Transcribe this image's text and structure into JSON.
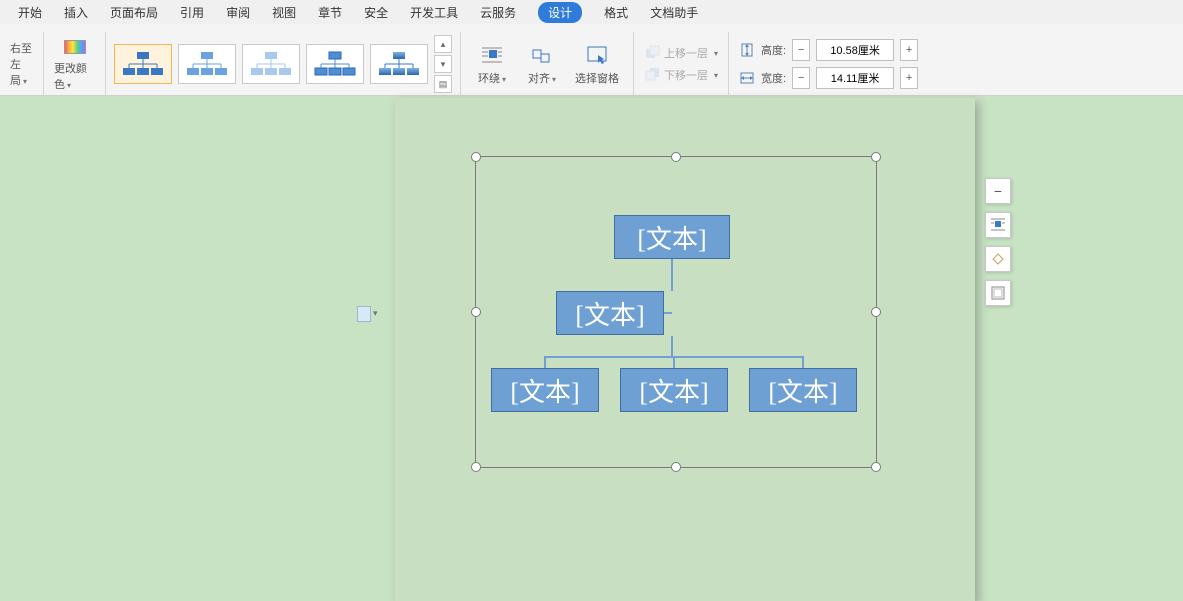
{
  "tabs": {
    "items": [
      "开始",
      "插入",
      "页面布局",
      "引用",
      "审阅",
      "视图",
      "章节",
      "安全",
      "开发工具",
      "云服务",
      "设计",
      "格式",
      "文档助手"
    ],
    "active_index": 10
  },
  "ribbon": {
    "rtl": {
      "l1": "右至左",
      "l2": "局"
    },
    "change_color": "更改颜色",
    "wrap": "环绕",
    "align": "对齐",
    "selection_pane": "选择窗格",
    "bring_forward": "上移一层",
    "send_backward": "下移一层",
    "height_label": "高度:",
    "width_label": "宽度:",
    "height_value": "10.58厘米",
    "width_value": "14.11厘米"
  },
  "smartart": {
    "placeholder": "[文本]"
  },
  "floatbar": {
    "collapse": "−",
    "textwrap": "wrap-icon",
    "layout": "layout-icon",
    "border": "border-icon"
  }
}
